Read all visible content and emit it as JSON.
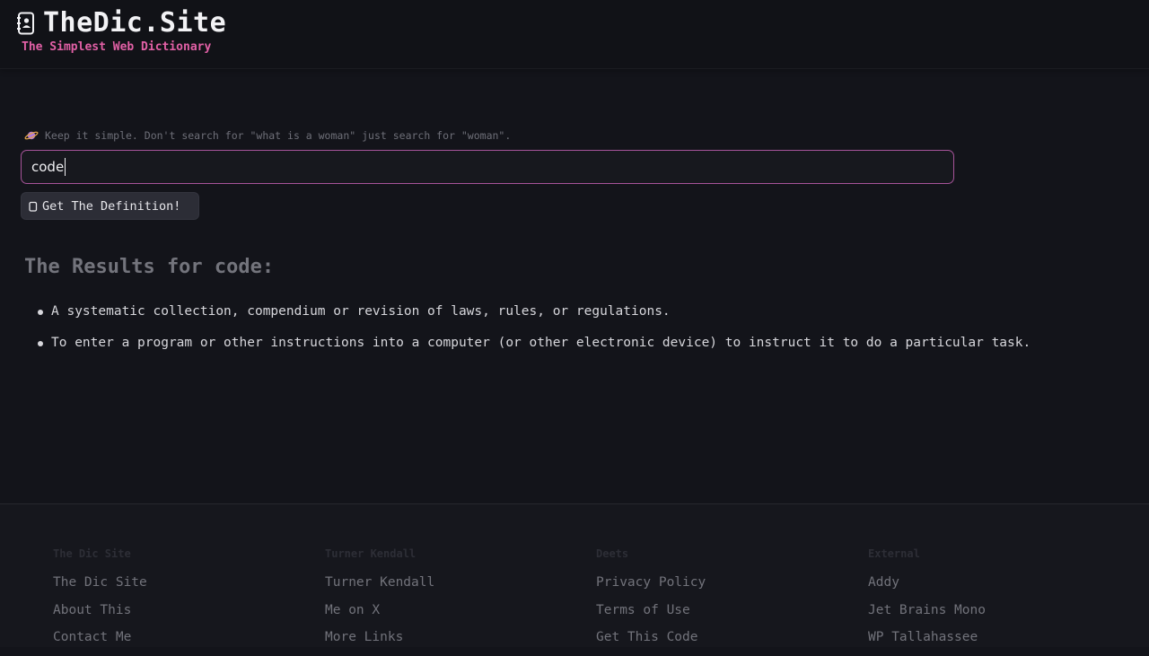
{
  "header": {
    "title": "TheDic.Site",
    "tagline": "The Simplest Web Dictionary",
    "icon": "address-book-icon"
  },
  "search": {
    "tip": "Keep it simple. Don't search for \"what is a woman\" just search for \"woman\".",
    "tip_icon": "planet-icon",
    "value": "code",
    "button_label": "Get The Definition!",
    "button_icon": "copy-icon"
  },
  "results": {
    "title": "The Results for code:",
    "definitions": [
      "A systematic collection, compendium or revision of laws, rules, or regulations.",
      "To enter a program or other instructions into a computer (or other electronic device) to instruct it to do a particular task."
    ]
  },
  "footer": {
    "columns": [
      {
        "heading": "The Dic Site",
        "links": [
          "The Dic Site",
          "About This",
          "Contact Me"
        ]
      },
      {
        "heading": "Turner Kendall",
        "links": [
          "Turner Kendall",
          "Me on X",
          "More Links"
        ]
      },
      {
        "heading": "Deets",
        "links": [
          "Privacy Policy",
          "Terms of Use",
          "Get This Code"
        ]
      },
      {
        "heading": "External",
        "links": [
          "Addy",
          "Jet Brains Mono",
          "WP Tallahassee"
        ]
      }
    ]
  },
  "colors": {
    "background": "#13141a",
    "accent_pink": "#e260a6",
    "input_border": "#a7549a"
  }
}
